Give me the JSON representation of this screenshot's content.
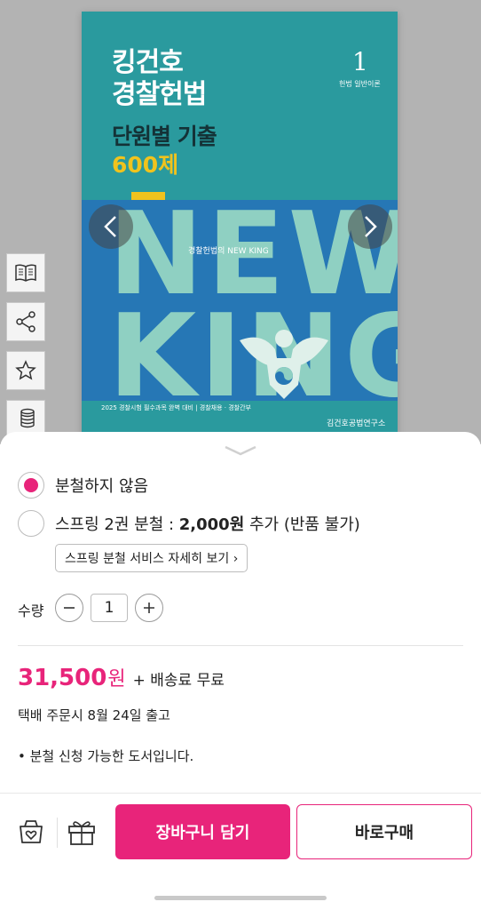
{
  "cover": {
    "title_line1": "킹건호",
    "title_line2": "경찰헌법",
    "subtitle": "단원별 기출",
    "count": "600제",
    "volume": "1",
    "volume_sub": "헌법 일반이론",
    "band_word1": "NEW",
    "band_word2": "KING",
    "band_tag": "경찰헌법의 NEW KING",
    "footer": "2025   경찰시험 필수과목 완벽 대비   |   경찰채용 · 경찰간부",
    "publisher": "김건호공법연구소",
    "colors": {
      "teal": "#2a9a9e",
      "blue": "#2677b5",
      "yellow": "#f0c31d"
    }
  },
  "side_icons": [
    "book-icon",
    "share-icon",
    "star-icon",
    "coins-icon"
  ],
  "options": {
    "no_split": "분철하지 않음",
    "split_prefix": "스프링 2권 분철 : ",
    "split_price": "2,000원",
    "split_suffix": " 추가 (반품 불가)",
    "selected": "no_split",
    "detail_link": "스프링 분철 서비스 자세히 보기 ›"
  },
  "quantity": {
    "label": "수량",
    "value": "1",
    "minus": "−",
    "plus": "+"
  },
  "price": {
    "amount": "31,500",
    "currency": "원",
    "shipping": "+ 배송료 무료"
  },
  "release": "택배 주문시 8월 24일 출고",
  "note": "• 분철 신청 가능한 도서입니다.",
  "actions": {
    "cart": "장바구니 담기",
    "buy": "바로구매"
  },
  "accent": "#e8247a"
}
